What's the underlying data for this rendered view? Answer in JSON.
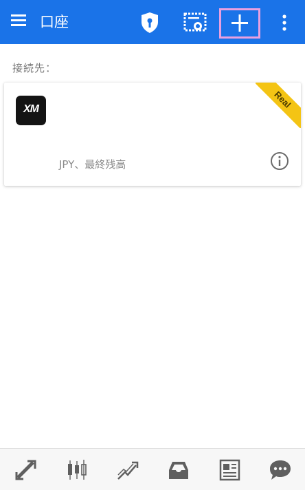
{
  "header": {
    "title": "口座",
    "icons": [
      "menu-icon",
      "shield-icon",
      "certificate-icon",
      "plus-icon",
      "more-vert-icon"
    ],
    "background": "#1a73e8",
    "highlight_color": "#e8a0e0"
  },
  "section_label": "接続先：",
  "account_card": {
    "logo_text": "XM",
    "badge": "Real",
    "balance_text": "JPY、最終残高",
    "badge_color": "#f4c414"
  },
  "bottom_nav": {
    "tabs": [
      "trade-arrows-icon",
      "candlestick-icon",
      "trend-chart-icon",
      "inbox-icon",
      "news-icon",
      "chat-icon"
    ]
  }
}
